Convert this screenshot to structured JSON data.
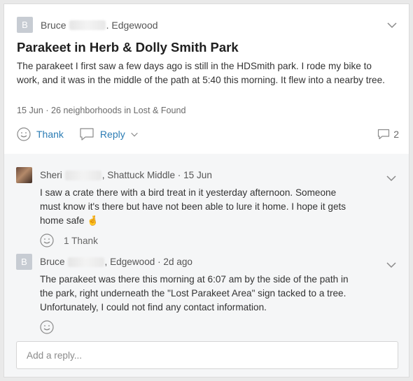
{
  "post": {
    "author_first": "Bruce",
    "author_location": ". Edgewood",
    "avatar_letter": "B",
    "title": "Parakeet in Herb & Dolly Smith Park",
    "body": "The parakeet I first saw a few days ago is still in the HDSmith park. I rode my bike to work, and it was in the middle of the path at 5:40 this morning. It flew into a nearby tree.",
    "date": "15 Jun",
    "audience": "26 neighborhoods in Lost & Found",
    "thank_label": "Thank",
    "reply_label": "Reply",
    "comment_count": "2"
  },
  "replies": [
    {
      "author_first": "Sheri",
      "author_suffix": ", Shattuck Middle · 15 Jun",
      "text": "I saw a crate there with a bird treat in it yesterday afternoon. Someone must know it's there but have not been able to lure it home. I hope it gets home safe 🤞",
      "thanks": "1 Thank"
    },
    {
      "author_first": "Bruce",
      "avatar_letter": "B",
      "author_suffix": ", Edgewood · 2d ago",
      "text": "The parakeet was there this morning at 6:07 am by the side of the path in the park, right underneath the \"Lost Parakeet Area\" sign tacked to a tree. Unfortunately, I could not find any contact information.",
      "thanks": ""
    }
  ],
  "reply_input": {
    "placeholder": "Add a reply...",
    "value": ""
  },
  "icons": {
    "avatar": "letter-avatar",
    "chevron": "chevron-down-icon",
    "thank": "smiley-icon",
    "reply": "speech-bubble-icon",
    "comments": "comment-count-icon"
  },
  "colors": {
    "link": "#2b7cb4",
    "avatar_bg": "#c7ccd3",
    "replies_bg": "#f5f6f7"
  }
}
